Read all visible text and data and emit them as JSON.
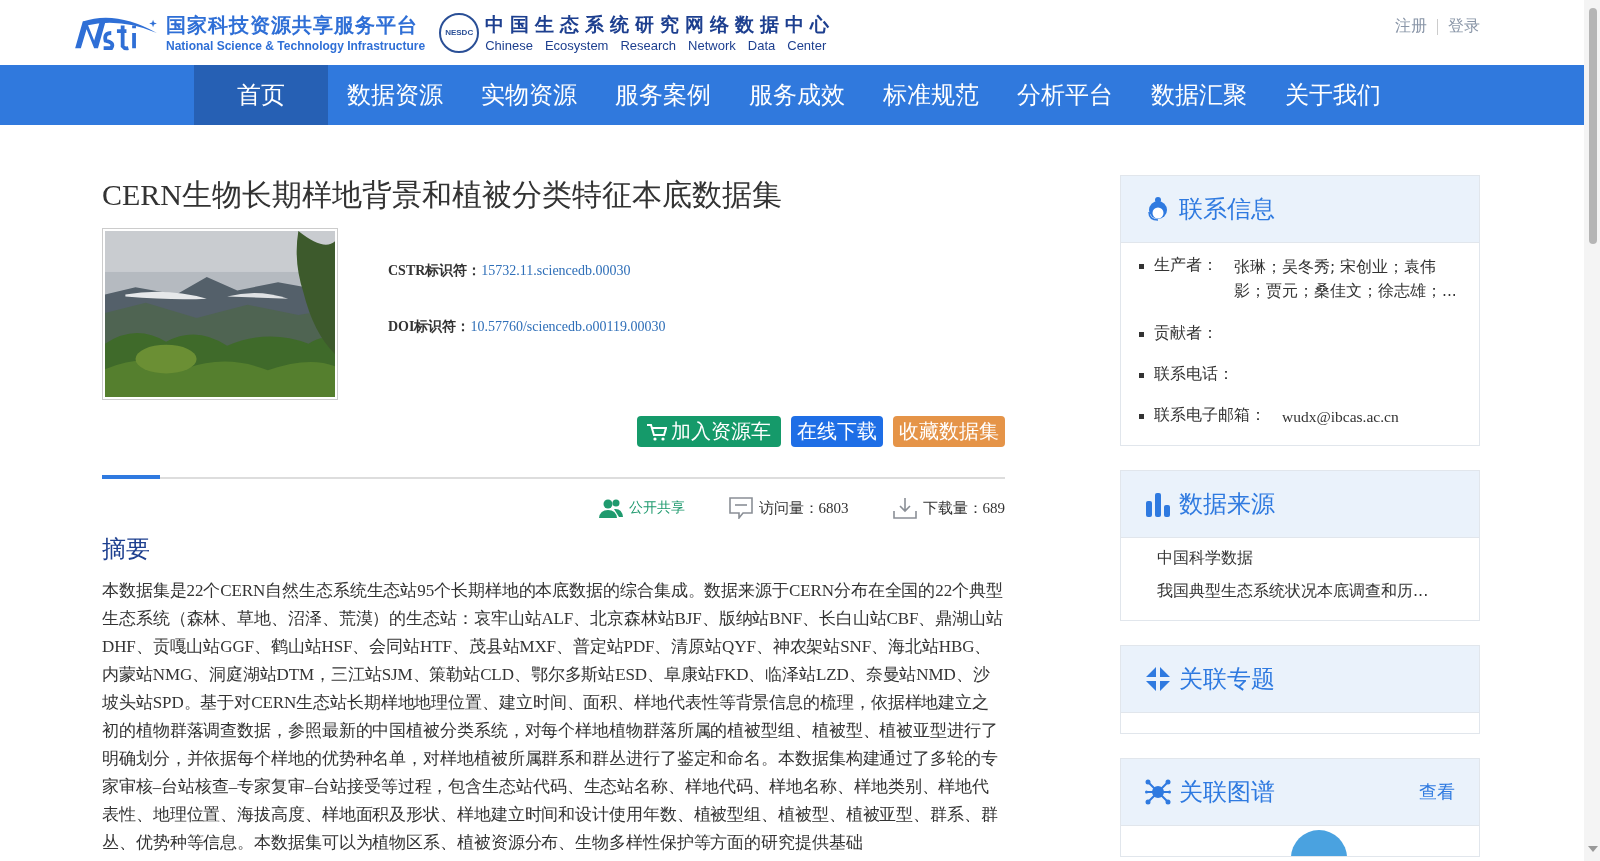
{
  "header": {
    "logo_cn": "国家科技资源共享服务平台",
    "logo_en": "National Science & Technology Infrastructure",
    "center_badge": "NESDC",
    "center_cn": "中国生态系统研究网络数据中心",
    "center_en": [
      "Chinese",
      "Ecosystem",
      "Research",
      "Network",
      "Data",
      "Center"
    ],
    "links": [
      "注册",
      "登录"
    ]
  },
  "nav": [
    {
      "label": "首页",
      "selected": true
    },
    {
      "label": "数据资源",
      "selected": false
    },
    {
      "label": "实物资源",
      "selected": false
    },
    {
      "label": "服务案例",
      "selected": false
    },
    {
      "label": "服务成效",
      "selected": false
    },
    {
      "label": "标准规范",
      "selected": false
    },
    {
      "label": "分析平台",
      "selected": false
    },
    {
      "label": "数据汇聚",
      "selected": false
    },
    {
      "label": "关于我们",
      "selected": false
    }
  ],
  "dataset": {
    "title": "CERN生物长期样地背景和植被分类特征本底数据集",
    "identifiers": [
      {
        "label": "CSTR标识符：",
        "value": "15732.11.sciencedb.00030"
      },
      {
        "label": "DOI标识符：",
        "value": "10.57760/sciencedb.o00119.00030"
      }
    ],
    "buttons": [
      {
        "label": "加入资源车",
        "kind": "cart"
      },
      {
        "label": "在线下载",
        "kind": "download"
      },
      {
        "label": "收藏数据集",
        "kind": "favorite"
      }
    ],
    "stats": [
      {
        "kind": "share",
        "text": "公开共享"
      },
      {
        "kind": "visits",
        "text": "访问量：6803"
      },
      {
        "kind": "downloads",
        "text": "下载量：689"
      }
    ],
    "abstract_heading": "摘要",
    "abstract": "本数据集是22个CERN自然生态系统生态站95个长期样地的本底数据的综合集成。数据来源于CERN分布在全国的22个典型生态系统（森林、草地、沼泽、荒漠）的生态站：哀牢山站ALF、北京森林站BJF、版纳站BNF、长白山站CBF、鼎湖山站DHF、贡嘎山站GGF、鹤山站HSF、会同站HTF、茂县站MXF、普定站PDF、清原站QYF、神农架站SNF、海北站HBG、内蒙站NMG、洞庭湖站DTM，三江站SJM、策勒站CLD、鄂尔多斯站ESD、阜康站FKD、临泽站LZD、奈曼站NMD、沙坡头站SPD。基于对CERN生态站长期样地地理位置、建立时间、面积、样地代表性等背景信息的梳理，依据样地建立之初的植物群落调查数据，参照最新的中国植被分类系统，对每个样地植物群落所属的植被型组、植被型、植被亚型进行了明确划分，并依据每个样地的优势种名单，对样地植被所属群系和群丛进行了鉴定和命名。本数据集构建通过了多轮的专家审核–台站核查–专家复审–台站接受等过程，包含生态站代码、生态站名称、样地代码、样地名称、样地类别、样地代表性、地理位置、海拔高度、样地面积及形状、样地建立时间和设计使用年数、植被型组、植被型、植被亚型、群系、群丛、优势种等信息。本数据集可以为植物区系、植被资源分布、生物多样性保护等方面的研究提供基础"
  },
  "sidebar": [
    {
      "kind": "contact",
      "title": "联系信息",
      "fields": [
        {
          "label": "生产者：",
          "value": "张琳；吴冬秀; 宋创业；袁伟影；贾元；桑佳文；徐志雄；..."
        },
        {
          "label": "贡献者："
        },
        {
          "label": "联系电话："
        },
        {
          "label": "联系电子邮箱：",
          "value": "wudx@ibcas.ac.cn"
        }
      ]
    },
    {
      "kind": "source",
      "title": "数据来源",
      "lines": [
        "中国科学数据",
        "我国典型生态系统状况本底调查和历..."
      ]
    },
    {
      "kind": "topic",
      "title": "关联专题"
    },
    {
      "kind": "graph",
      "title": "关联图谱",
      "link": "查看"
    }
  ]
}
